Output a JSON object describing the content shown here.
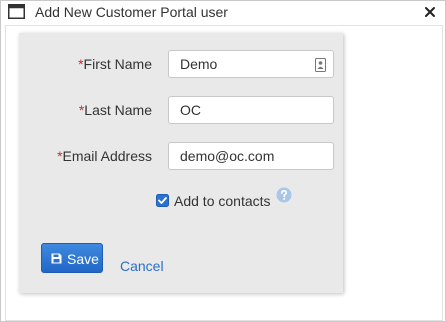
{
  "window": {
    "title": "Add New Customer Portal user",
    "icons": {
      "app": "window-icon",
      "close": "close-icon"
    }
  },
  "form": {
    "required_mark": "*",
    "first_name": {
      "label": "First Name",
      "value": "Demo",
      "icon": "contact-card-icon"
    },
    "last_name": {
      "label": "Last Name",
      "value": "OC"
    },
    "email": {
      "label": "Email Address",
      "value": "demo@oc.com"
    },
    "add_to_contacts": {
      "label": "Add to contacts",
      "checked": true,
      "help_icon": "help-icon"
    }
  },
  "actions": {
    "save_label": "Save",
    "save_icon": "floppy-disk-icon",
    "cancel_label": "Cancel"
  },
  "colors": {
    "required": "#cc2a2a",
    "save_button": "#2a72d2",
    "link": "#2a6fc9",
    "panel": "#e9e9e9"
  }
}
